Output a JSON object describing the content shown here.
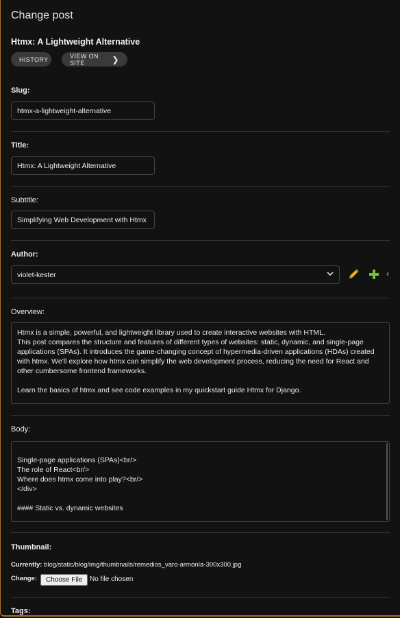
{
  "page": {
    "title": "Change post"
  },
  "object": {
    "title": "Htmx: A Lightweight Alternative",
    "history_label": "HISTORY",
    "view_on_site_label": "VIEW ON SITE"
  },
  "fields": {
    "slug": {
      "label": "Slug:",
      "value": "htmx-a-lightweight-alternative"
    },
    "title": {
      "label": "Title:",
      "value": "Htmx: A Lightweight Alternative"
    },
    "subtitle": {
      "label": "Subtitle:",
      "value": "Simplifying Web Development with Htmx"
    },
    "author": {
      "label": "Author:",
      "value": "violet-kester"
    },
    "overview": {
      "label": "Overview:",
      "value": "Htmx is a simple, powerful, and lightweight library used to create interactive websites with HTML.\nThis post compares the structure and features of different types of websites: static, dynamic, and single-page applications (SPAs). It introduces the game-changing concept of hypermedia-driven applications (HDAs) created with htmx. We'll explore how htmx can simplify the web development process, reducing the need for React and other cumbersome frontend frameworks.\n\nLearn the basics of htmx and see code examples in my quickstart guide Htmx for Django."
    },
    "body": {
      "label": "Body:",
      "value": "Single-page applications (SPAs)<br/>\nThe role of React<br/>\nWhere does htmx come into play?<br/>\n</div>\n\n#### Static vs. dynamic websites\n\nWhen you visit a page on a website, your browser sends an *HTTP request* to the web server hosting the site to ask it for a specific resource."
    },
    "thumbnail": {
      "label": "Thumbnail:",
      "currently_label": "Currently:",
      "currently_value": "blog/static/blog/img/thumbnails/remedios_varo-armonía-300x300.jpg",
      "change_label": "Change:",
      "choose_file_label": "Choose File",
      "no_file_label": "No file chosen"
    },
    "tags": {
      "label": "Tags:"
    }
  },
  "icons": {
    "pencil": "pencil-icon",
    "plus": "plus-icon",
    "chevron": "chevron-right-icon",
    "caret": "chevron-down-icon"
  },
  "colors": {
    "background": "#121212",
    "accent": "#b3731c",
    "pencil": "#e6b422",
    "plus": "#6fc13a",
    "link": "#5aa0e0"
  }
}
